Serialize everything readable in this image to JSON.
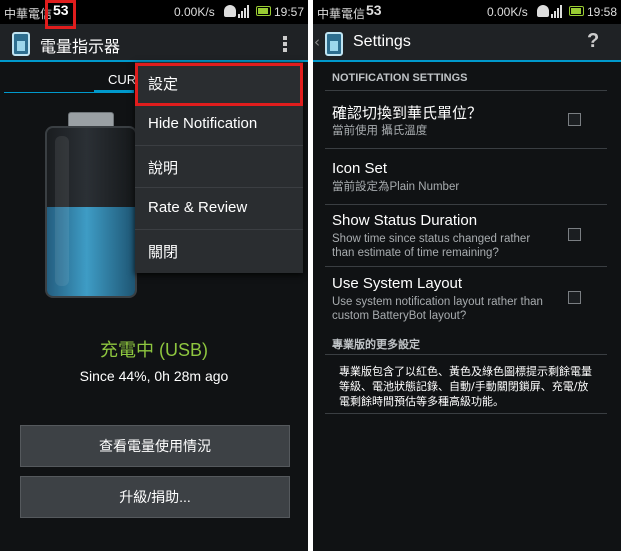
{
  "left": {
    "status": {
      "carrier": "中華電信",
      "notif_count": "53",
      "speed": "0.00K/s",
      "time": "19:57"
    },
    "app_title": "電量指示器",
    "tab_partial": "CUR",
    "charge_status": "充電中 (USB)",
    "since": "Since 44%, 0h 28m ago",
    "battery_level": 0.53,
    "buttons": {
      "usage": "查看電量使用情況",
      "upgrade": "升級/捐助..."
    },
    "menu": [
      "設定",
      "Hide Notification",
      "說明",
      "Rate & Review",
      "關閉"
    ]
  },
  "right": {
    "status": {
      "carrier": "中華電信",
      "notif_count": "53",
      "speed": "0.00K/s",
      "time": "19:58"
    },
    "title": "Settings",
    "section_header": "NOTIFICATION SETTINGS",
    "items": [
      {
        "title": "確認切換到華氏單位？",
        "summary": "當前使用 攝氏溫度",
        "checked": false
      },
      {
        "title": "Icon Set",
        "summary": "當前設定為Plain Number"
      },
      {
        "title": "Show Status Duration",
        "summary": "Show time since status changed rather than estimate of time remaining?",
        "checked": false
      },
      {
        "title": "Use System Layout",
        "summary": "Use system notification layout rather than custom BatteryBot layout?",
        "checked": false
      }
    ],
    "pro_header": "專業版的更多設定",
    "pro_text": "專業版包含了以紅色、黃色及綠色圖標提示剩餘電量等級、電池狀態記錄、自動/手動關閉鎖屏、充電/放電剩餘時間預估等多種高級功能。"
  },
  "colors": {
    "accent": "#0099cc",
    "charging_green": "#8ec63f",
    "highlight_red": "#e01d1d"
  }
}
